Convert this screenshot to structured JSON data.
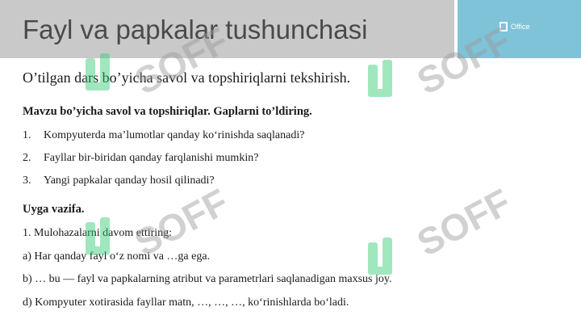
{
  "header": {
    "title": "Fayl va papkalar tushunchasi",
    "logo_text": "Office"
  },
  "subtitle": "O’tilgan dars bo’yicha savol va topshiriqlarni tekshirish.",
  "questions": {
    "heading": "Mavzu bo’yicha savol va topshiriqlar. Gaplarni to’ldiring.",
    "items": [
      {
        "num": "1.",
        "text": "Kompyuterda ma’lumotlar qanday ko‘rinishda saqlanadi?"
      },
      {
        "num": "2.",
        "text": "Fayllar bir-biridan qanday farqlanishi mumkin?"
      },
      {
        "num": "3.",
        "text": "Yangi papkalar qanday hosil qilinadi?"
      }
    ]
  },
  "homework": {
    "heading": "Uyga vazifa.",
    "lines": [
      "1. Mulohazalarni davom ettiring:",
      "a) Har qanday fayl o‘z nomi va …ga ega.",
      "b) … bu — fayl va papkalarning atribut va parametrlari saqlanadigan maxsus joy.",
      "d) Kompyuter xotirasida fayllar matn, …, …, …, ko‘rinishlarda bo‘ladi."
    ]
  },
  "watermark": {
    "text": "SOFF",
    "color": "#2ecc71"
  }
}
